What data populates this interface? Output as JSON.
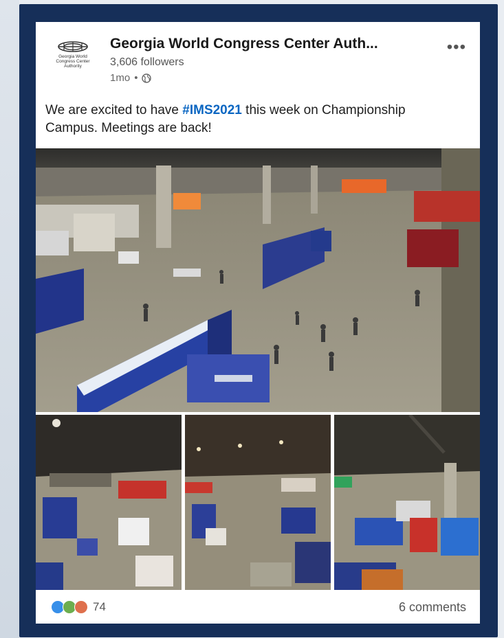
{
  "post": {
    "author": "Georgia World Congress Center Auth...",
    "logo_text": "Georgia World Congress Center Authority",
    "followers": "3,606 followers",
    "time": "1mo",
    "separator": "•",
    "text_before": "We are excited to have ",
    "hashtag": "#IMS2021",
    "text_after": " this week on Championship Campus. Meetings are back!",
    "more_label": "•••"
  },
  "footer": {
    "reaction_count": "74",
    "comments": "6 comments",
    "reactions": [
      "like-icon",
      "celebrate-icon",
      "love-icon"
    ]
  },
  "colors": {
    "frame": "#162f59",
    "link": "#0a66c2",
    "like": "#378fe9",
    "celebrate": "#6dae4f",
    "love": "#df704d"
  },
  "photos": [
    "expo-hall-overview",
    "expo-hall-view-1",
    "expo-hall-view-2",
    "expo-hall-view-3"
  ]
}
